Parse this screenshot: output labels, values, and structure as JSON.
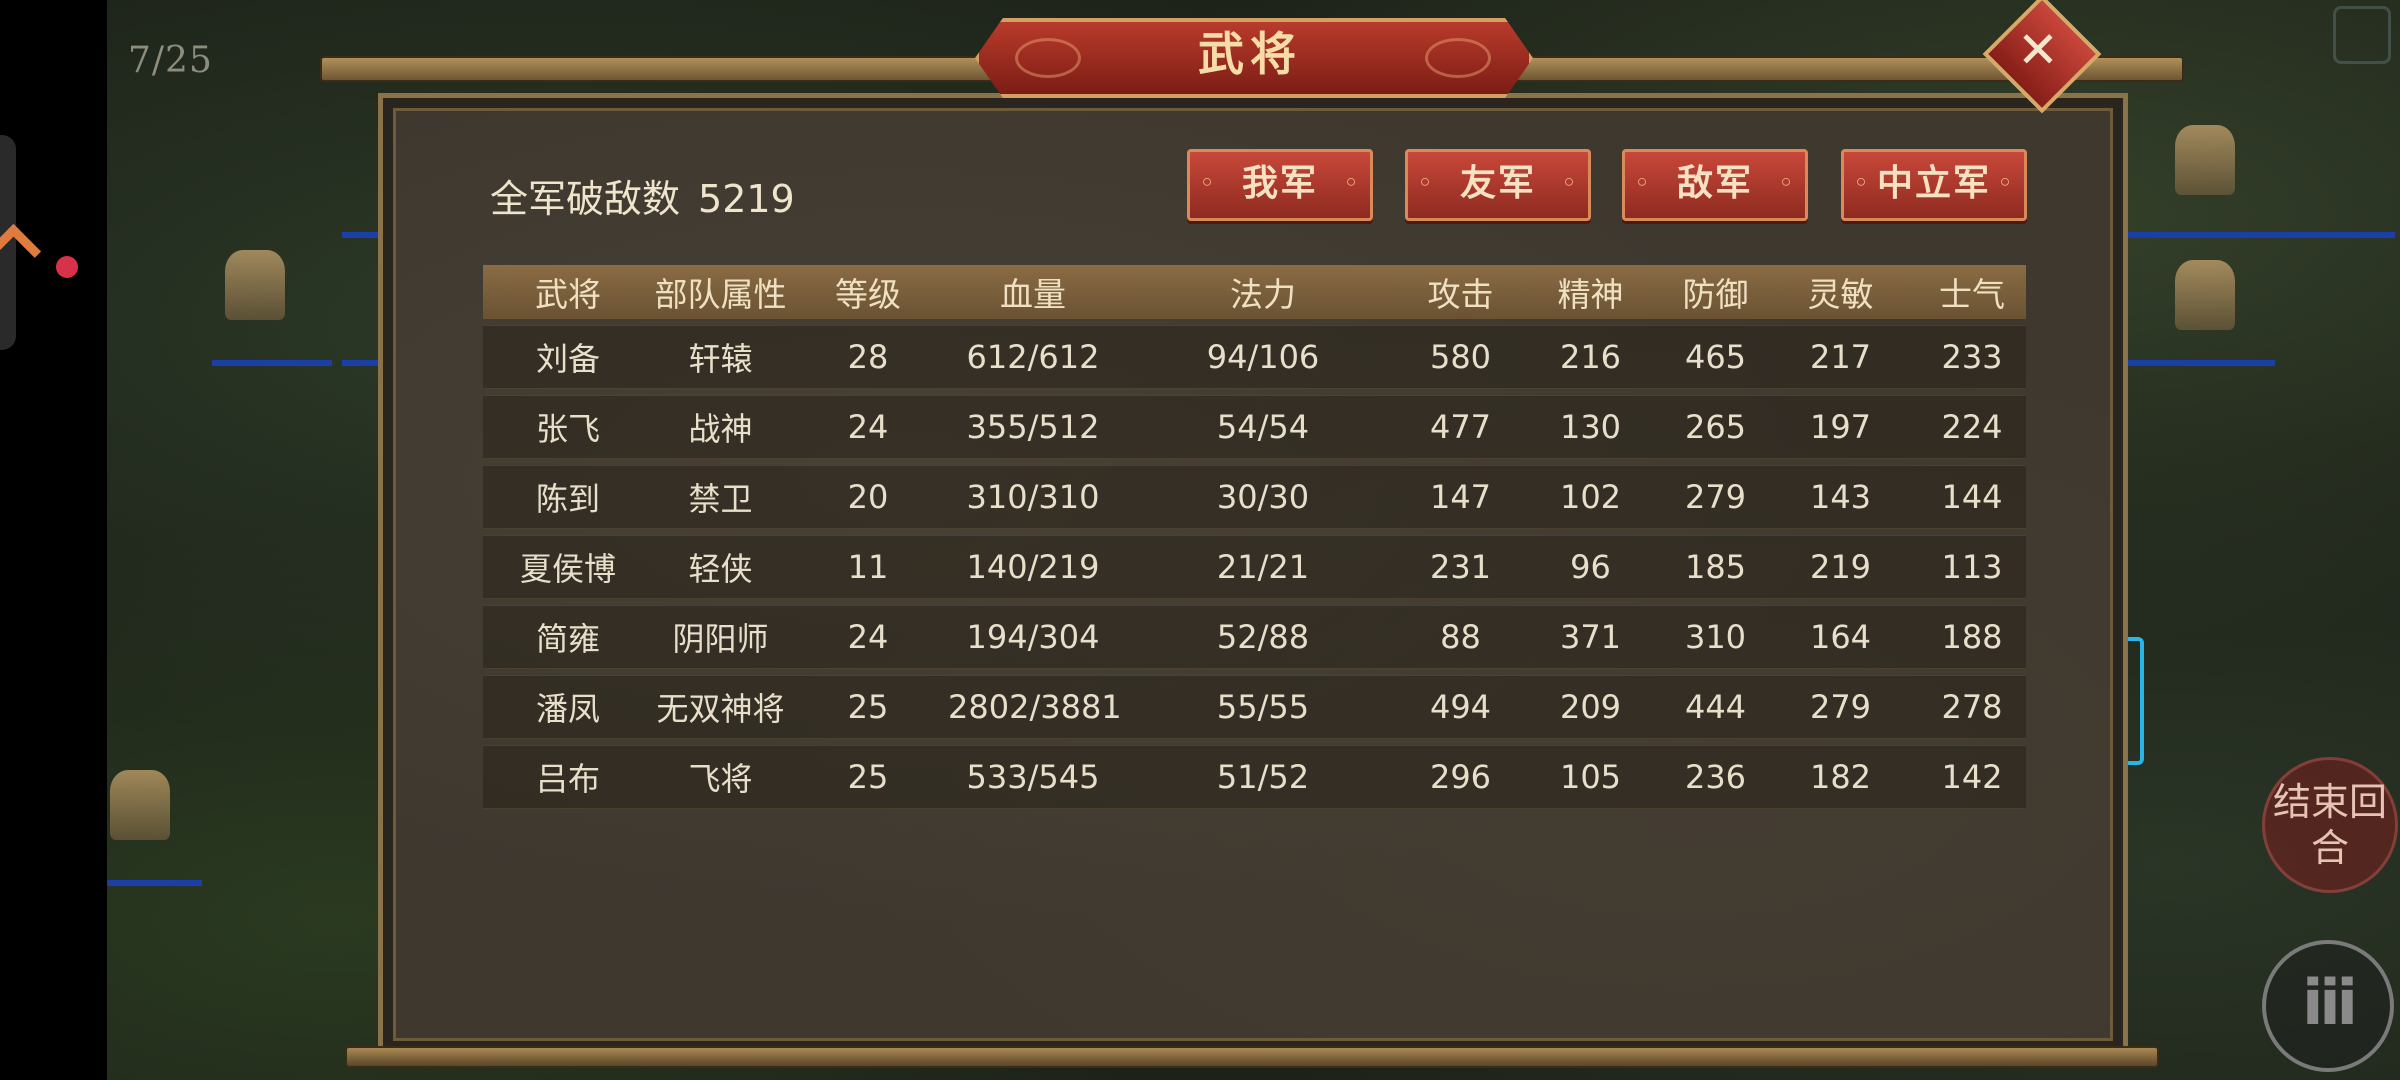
{
  "hud": {
    "turn_counter": "7/25",
    "end_turn_label": "结束回合",
    "menu_label": "iii"
  },
  "dialog": {
    "title": "武将",
    "close_symbol": "✕",
    "kill_label": "全军破敌数",
    "kill_value": "5219",
    "tabs": [
      "我军",
      "友军",
      "敌军",
      "中立军"
    ]
  },
  "table": {
    "headers": [
      "武将",
      "部队属性",
      "等级",
      "血量",
      "法力",
      "攻击",
      "精神",
      "防御",
      "灵敏",
      "士气"
    ],
    "rows": [
      [
        "刘备",
        "轩辕",
        "28",
        "612/612",
        "94/106",
        "580",
        "216",
        "465",
        "217",
        "233"
      ],
      [
        "张飞",
        "战神",
        "24",
        "355/512",
        "54/54",
        "477",
        "130",
        "265",
        "197",
        "224"
      ],
      [
        "陈到",
        "禁卫",
        "20",
        "310/310",
        "30/30",
        "147",
        "102",
        "279",
        "143",
        "144"
      ],
      [
        "夏侯博",
        "轻侠",
        "11",
        "140/219",
        "21/21",
        "231",
        "96",
        "185",
        "219",
        "113"
      ],
      [
        "简雍",
        "阴阳师",
        "24",
        "194/304",
        "52/88",
        "88",
        "371",
        "310",
        "164",
        "188"
      ],
      [
        "潘凤",
        "无双神将",
        "25",
        "2802/3881",
        "55/55",
        "494",
        "209",
        "444",
        "279",
        "278"
      ],
      [
        "吕布",
        "飞将",
        "25",
        "533/545",
        "51/52",
        "296",
        "105",
        "236",
        "182",
        "142"
      ]
    ]
  },
  "colors": {
    "panel": "#3e382f",
    "accent_red": "#b93b2b",
    "gold": "#d2a062",
    "header_bar": "#8a6c45"
  }
}
